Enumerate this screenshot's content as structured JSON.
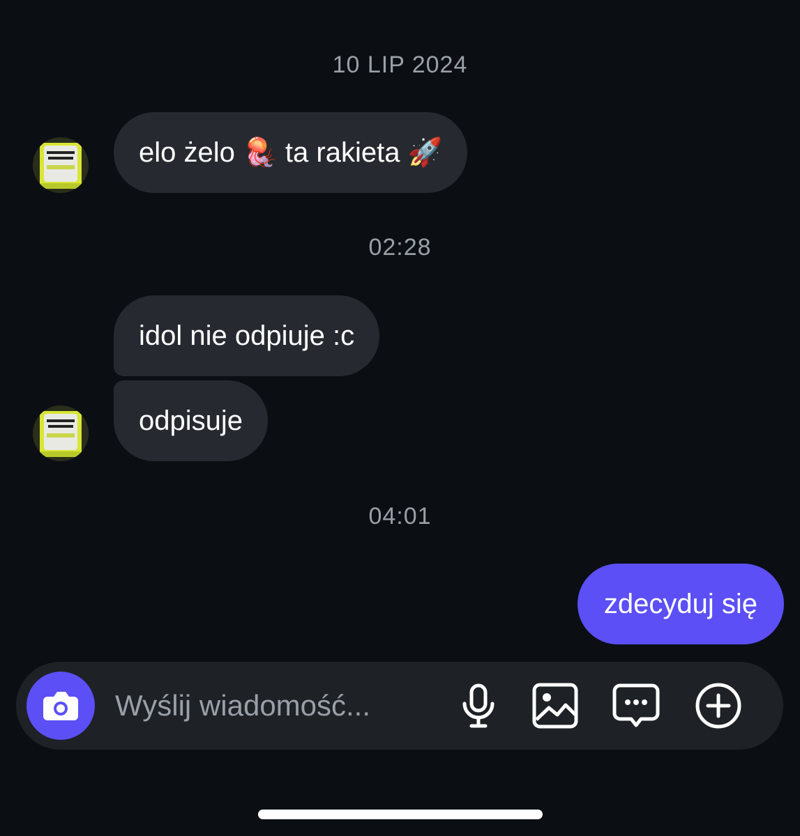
{
  "thread": {
    "timestamps": {
      "first": "10 LIP 2024",
      "second": "02:28",
      "third": "04:01"
    },
    "messages": [
      {
        "text": "elo żelo 🪼 ta rakieta 🚀",
        "direction": "incoming"
      },
      {
        "text": "idol nie odpiuje :c",
        "direction": "incoming"
      },
      {
        "text": "odpisuje",
        "direction": "incoming"
      },
      {
        "text": "zdecyduj się",
        "direction": "outgoing"
      }
    ]
  },
  "composer": {
    "placeholder": "Wyślij wiadomość...",
    "icons": [
      "camera-icon",
      "microphone-icon",
      "gallery-icon",
      "sticker-chat-icon",
      "plus-circle-icon"
    ]
  },
  "colors": {
    "background": "#0b0f14",
    "incoming_bubble": "#262a30",
    "outgoing_bubble": "#5b4ff5",
    "timestamp_text": "#9aa0a8",
    "composer_bg": "#1e2126"
  }
}
